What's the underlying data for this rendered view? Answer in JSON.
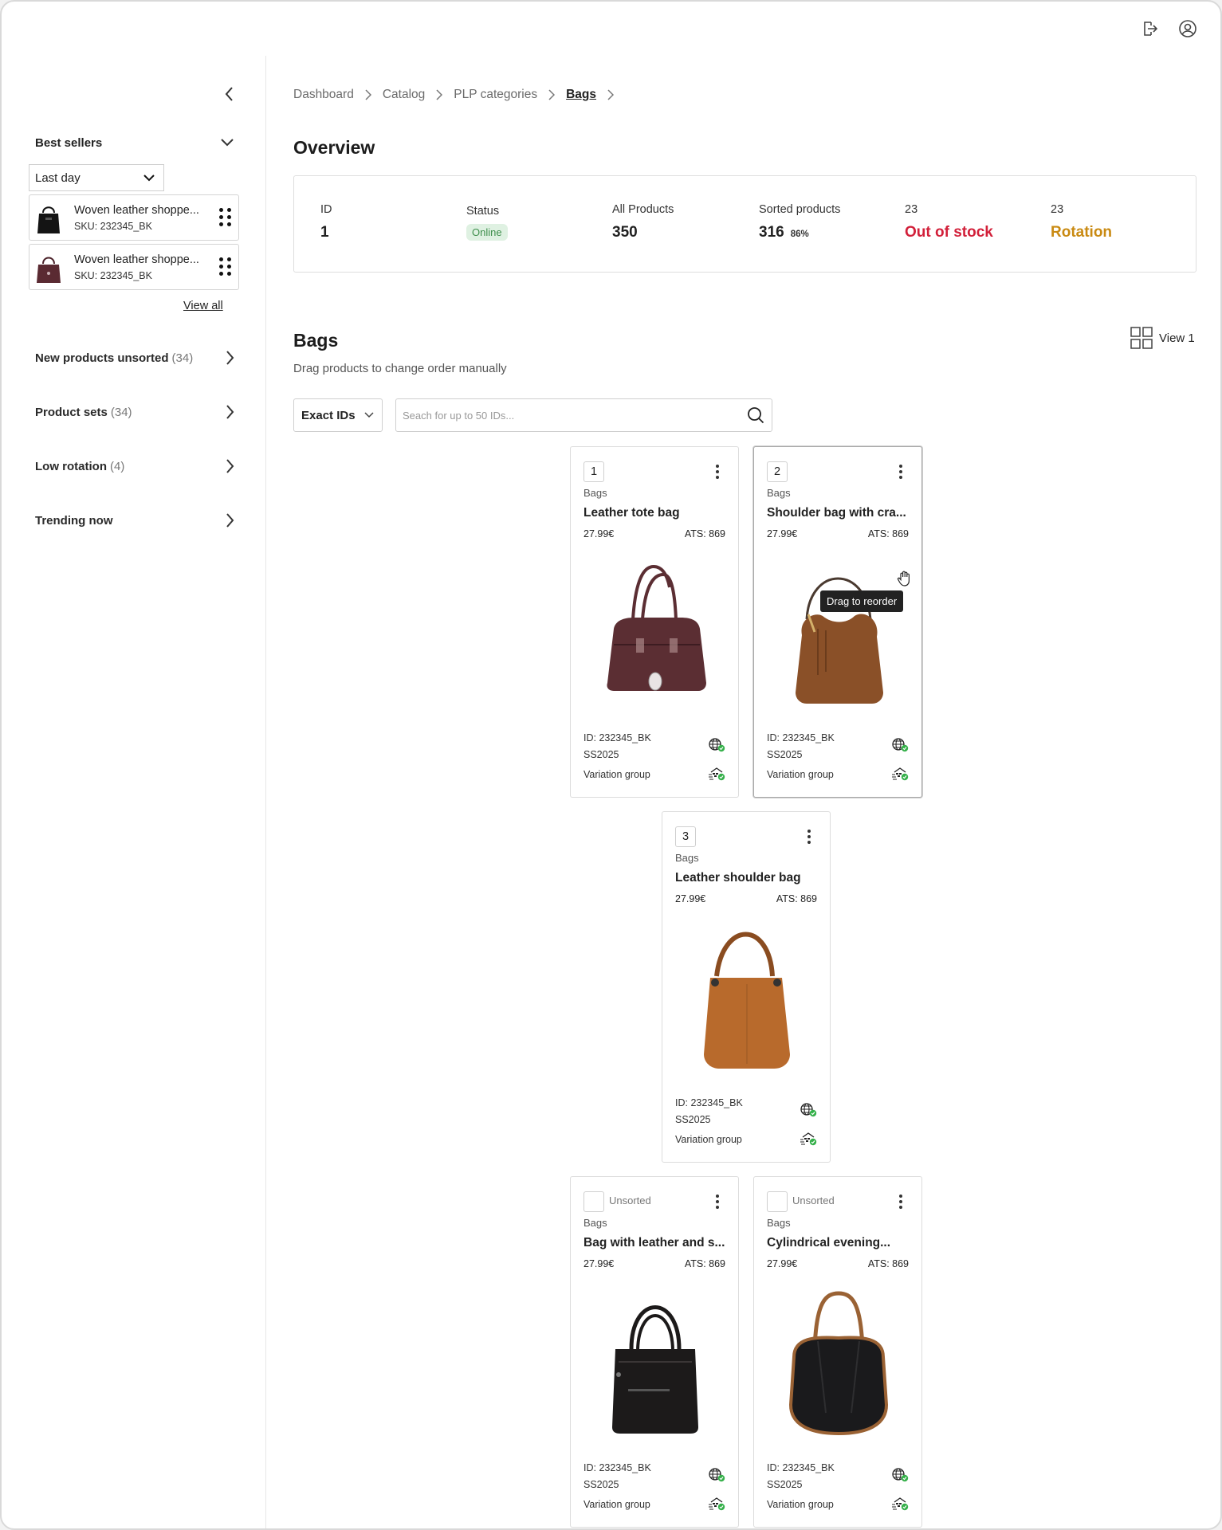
{
  "colors": {
    "accent_red": "#d2203a",
    "accent_amber": "#c98a12",
    "online_bg": "#dff1e2",
    "online_text": "#3f8f4d",
    "ok_green": "#35b04a"
  },
  "topbar": {
    "icons": [
      "logout-icon",
      "user-circle-icon"
    ]
  },
  "sidebar": {
    "best_sellers": {
      "title": "Best sellers",
      "period": "Last day",
      "items": [
        {
          "name": "Woven leather shoppe...",
          "sku": "SKU: 232345_BK",
          "thumb_color": "#1a1a1a"
        },
        {
          "name": "Woven leather shoppe...",
          "sku": "SKU: 232345_BK",
          "thumb_color": "#5a2a32"
        }
      ],
      "view_all": "View all"
    },
    "links": [
      {
        "label": "New products unsorted",
        "count": "(34)"
      },
      {
        "label": "Product sets",
        "count": "(34)"
      },
      {
        "label": "Low rotation",
        "count": "(4)"
      },
      {
        "label": "Trending now",
        "count": ""
      }
    ]
  },
  "breadcrumb": [
    "Dashboard",
    "Catalog",
    "PLP categories",
    "Bags"
  ],
  "overview": {
    "title": "Overview",
    "id_label": "ID",
    "id_value": "1",
    "status_label": "Status",
    "status_value": "Online",
    "all_label": "All Products",
    "all_value": "350",
    "sorted_label": "Sorted products",
    "sorted_value": "316",
    "sorted_pct": "86%",
    "oos_count": "23",
    "oos_label": "Out of stock",
    "rot_count": "23",
    "rot_label": "Rotation"
  },
  "bags": {
    "title": "Bags",
    "subtitle": "Drag products to change order manually",
    "view_label": "View 1",
    "filter": "Exact IDs",
    "search_placeholder": "Seach for up to 50 IDs..."
  },
  "tooltip": "Drag to reorder",
  "products": [
    {
      "num": "1",
      "unsorted": "",
      "category": "Bags",
      "name": "Leather tote bag",
      "price": "27.99€",
      "ats": "ATS: 869",
      "id": "ID: 232345_BK",
      "season": "SS2025",
      "variation": "Variation group",
      "bag_color": "#5b2e33",
      "bag_shape": "tote"
    },
    {
      "num": "2",
      "unsorted": "",
      "category": "Bags",
      "name": "Shoulder bag with cra...",
      "price": "27.99€",
      "ats": "ATS: 869",
      "id": "ID: 232345_BK",
      "season": "SS2025",
      "variation": "Variation group",
      "bag_color": "#8a5028",
      "bag_shape": "hobo"
    },
    {
      "num": "3",
      "unsorted": "",
      "category": "Bags",
      "name": "Leather shoulder bag",
      "price": "27.99€",
      "ats": "ATS: 869",
      "id": "ID: 232345_BK",
      "season": "SS2025",
      "variation": "Variation group",
      "bag_color": "#b86a2c",
      "bag_shape": "bucket"
    },
    {
      "num": "",
      "unsorted": "Unsorted",
      "category": "Bags",
      "name": "Bag with leather and s...",
      "price": "27.99€",
      "ats": "ATS: 869",
      "id": "ID: 232345_BK",
      "season": "SS2025",
      "variation": "Variation group",
      "bag_color": "#1c1a1a",
      "bag_shape": "shopper"
    },
    {
      "num": "",
      "unsorted": "Unsorted",
      "category": "Bags",
      "name": "Cylindrical evening...",
      "price": "27.99€",
      "ats": "ATS: 869",
      "id": "ID: 232345_BK",
      "season": "SS2025",
      "variation": "Variation group",
      "bag_color": "#1a1a1c",
      "bag_shape": "cylinder"
    }
  ]
}
